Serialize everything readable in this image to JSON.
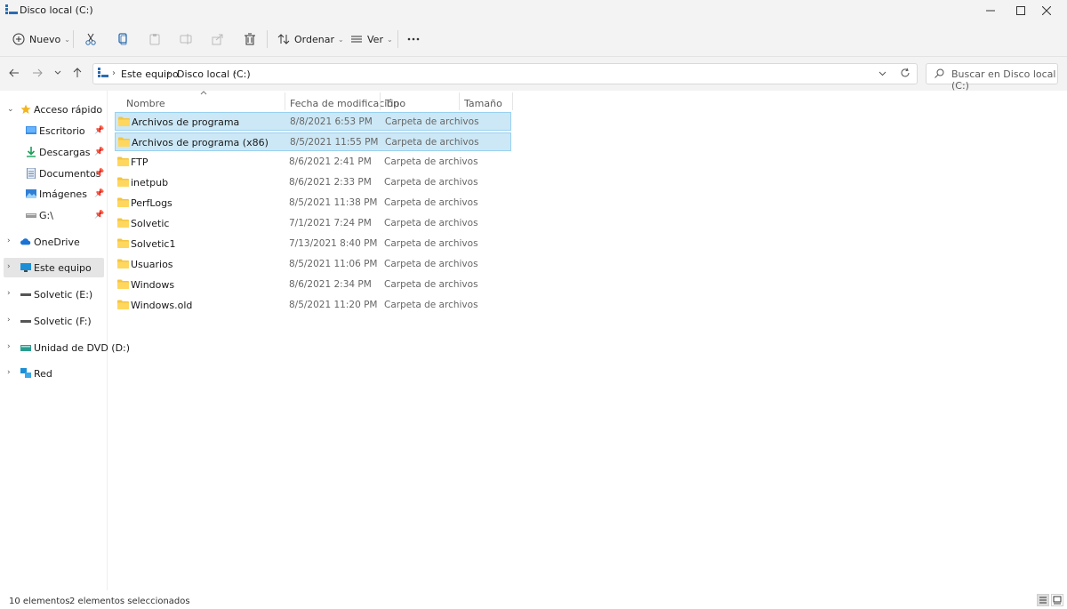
{
  "window": {
    "title": "Disco local (C:)"
  },
  "commandbar": {
    "new_label": "Nuevo",
    "sort_label": "Ordenar",
    "view_label": "Ver"
  },
  "address": {
    "crumbs": [
      "Este equipo",
      "Disco local (C:)"
    ],
    "search_placeholder": "Buscar en Disco local (C:)"
  },
  "sidebar": {
    "quick_access": "Acceso rápido",
    "quick_items": [
      {
        "label": "Escritorio",
        "icon": "desktop-icon"
      },
      {
        "label": "Descargas",
        "icon": "download-icon"
      },
      {
        "label": "Documentos",
        "icon": "documents-icon"
      },
      {
        "label": "Imágenes",
        "icon": "images-icon"
      },
      {
        "label": "G:\\",
        "icon": "drive-icon"
      }
    ],
    "onedrive": "OneDrive",
    "this_pc": "Este equipo",
    "drive_e": "Solvetic (E:)",
    "drive_f": "Solvetic (F:)",
    "dvd": "Unidad de DVD (D:)",
    "network": "Red"
  },
  "columns": {
    "name": "Nombre",
    "date": "Fecha de modificación",
    "type": "Tipo",
    "size": "Tamaño"
  },
  "files": [
    {
      "name": "Archivos de programa",
      "date": "8/8/2021 6:53 PM",
      "type": "Carpeta de archivos",
      "selected": true
    },
    {
      "name": "Archivos de programa (x86)",
      "date": "8/5/2021 11:55 PM",
      "type": "Carpeta de archivos",
      "selected": true
    },
    {
      "name": "FTP",
      "date": "8/6/2021 2:41 PM",
      "type": "Carpeta de archivos",
      "selected": false
    },
    {
      "name": "inetpub",
      "date": "8/6/2021 2:33 PM",
      "type": "Carpeta de archivos",
      "selected": false
    },
    {
      "name": "PerfLogs",
      "date": "8/5/2021 11:38 PM",
      "type": "Carpeta de archivos",
      "selected": false
    },
    {
      "name": "Solvetic",
      "date": "7/1/2021 7:24 PM",
      "type": "Carpeta de archivos",
      "selected": false
    },
    {
      "name": "Solvetic1",
      "date": "7/13/2021 8:40 PM",
      "type": "Carpeta de archivos",
      "selected": false
    },
    {
      "name": "Usuarios",
      "date": "8/5/2021 11:06 PM",
      "type": "Carpeta de archivos",
      "selected": false
    },
    {
      "name": "Windows",
      "date": "8/6/2021 2:34 PM",
      "type": "Carpeta de archivos",
      "selected": false
    },
    {
      "name": "Windows.old",
      "date": "8/5/2021 11:20 PM",
      "type": "Carpeta de archivos",
      "selected": false
    }
  ],
  "status": {
    "count": "10 elementos",
    "selected": "2 elementos seleccionados"
  },
  "colors": {
    "selection_bg": "#cce8f6",
    "selection_border": "#99d1f0",
    "folder": "#f4c542",
    "accent": "#0067c0"
  }
}
